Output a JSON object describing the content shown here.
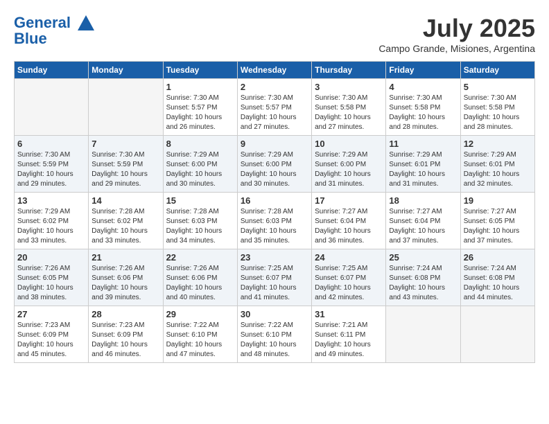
{
  "header": {
    "logo_line1": "General",
    "logo_line2": "Blue",
    "month": "July 2025",
    "location": "Campo Grande, Misiones, Argentina"
  },
  "days_of_week": [
    "Sunday",
    "Monday",
    "Tuesday",
    "Wednesday",
    "Thursday",
    "Friday",
    "Saturday"
  ],
  "weeks": [
    [
      {
        "num": "",
        "info": ""
      },
      {
        "num": "",
        "info": ""
      },
      {
        "num": "1",
        "info": "Sunrise: 7:30 AM\nSunset: 5:57 PM\nDaylight: 10 hours\nand 26 minutes."
      },
      {
        "num": "2",
        "info": "Sunrise: 7:30 AM\nSunset: 5:57 PM\nDaylight: 10 hours\nand 27 minutes."
      },
      {
        "num": "3",
        "info": "Sunrise: 7:30 AM\nSunset: 5:58 PM\nDaylight: 10 hours\nand 27 minutes."
      },
      {
        "num": "4",
        "info": "Sunrise: 7:30 AM\nSunset: 5:58 PM\nDaylight: 10 hours\nand 28 minutes."
      },
      {
        "num": "5",
        "info": "Sunrise: 7:30 AM\nSunset: 5:58 PM\nDaylight: 10 hours\nand 28 minutes."
      }
    ],
    [
      {
        "num": "6",
        "info": "Sunrise: 7:30 AM\nSunset: 5:59 PM\nDaylight: 10 hours\nand 29 minutes."
      },
      {
        "num": "7",
        "info": "Sunrise: 7:30 AM\nSunset: 5:59 PM\nDaylight: 10 hours\nand 29 minutes."
      },
      {
        "num": "8",
        "info": "Sunrise: 7:29 AM\nSunset: 6:00 PM\nDaylight: 10 hours\nand 30 minutes."
      },
      {
        "num": "9",
        "info": "Sunrise: 7:29 AM\nSunset: 6:00 PM\nDaylight: 10 hours\nand 30 minutes."
      },
      {
        "num": "10",
        "info": "Sunrise: 7:29 AM\nSunset: 6:00 PM\nDaylight: 10 hours\nand 31 minutes."
      },
      {
        "num": "11",
        "info": "Sunrise: 7:29 AM\nSunset: 6:01 PM\nDaylight: 10 hours\nand 31 minutes."
      },
      {
        "num": "12",
        "info": "Sunrise: 7:29 AM\nSunset: 6:01 PM\nDaylight: 10 hours\nand 32 minutes."
      }
    ],
    [
      {
        "num": "13",
        "info": "Sunrise: 7:29 AM\nSunset: 6:02 PM\nDaylight: 10 hours\nand 33 minutes."
      },
      {
        "num": "14",
        "info": "Sunrise: 7:28 AM\nSunset: 6:02 PM\nDaylight: 10 hours\nand 33 minutes."
      },
      {
        "num": "15",
        "info": "Sunrise: 7:28 AM\nSunset: 6:03 PM\nDaylight: 10 hours\nand 34 minutes."
      },
      {
        "num": "16",
        "info": "Sunrise: 7:28 AM\nSunset: 6:03 PM\nDaylight: 10 hours\nand 35 minutes."
      },
      {
        "num": "17",
        "info": "Sunrise: 7:27 AM\nSunset: 6:04 PM\nDaylight: 10 hours\nand 36 minutes."
      },
      {
        "num": "18",
        "info": "Sunrise: 7:27 AM\nSunset: 6:04 PM\nDaylight: 10 hours\nand 37 minutes."
      },
      {
        "num": "19",
        "info": "Sunrise: 7:27 AM\nSunset: 6:05 PM\nDaylight: 10 hours\nand 37 minutes."
      }
    ],
    [
      {
        "num": "20",
        "info": "Sunrise: 7:26 AM\nSunset: 6:05 PM\nDaylight: 10 hours\nand 38 minutes."
      },
      {
        "num": "21",
        "info": "Sunrise: 7:26 AM\nSunset: 6:06 PM\nDaylight: 10 hours\nand 39 minutes."
      },
      {
        "num": "22",
        "info": "Sunrise: 7:26 AM\nSunset: 6:06 PM\nDaylight: 10 hours\nand 40 minutes."
      },
      {
        "num": "23",
        "info": "Sunrise: 7:25 AM\nSunset: 6:07 PM\nDaylight: 10 hours\nand 41 minutes."
      },
      {
        "num": "24",
        "info": "Sunrise: 7:25 AM\nSunset: 6:07 PM\nDaylight: 10 hours\nand 42 minutes."
      },
      {
        "num": "25",
        "info": "Sunrise: 7:24 AM\nSunset: 6:08 PM\nDaylight: 10 hours\nand 43 minutes."
      },
      {
        "num": "26",
        "info": "Sunrise: 7:24 AM\nSunset: 6:08 PM\nDaylight: 10 hours\nand 44 minutes."
      }
    ],
    [
      {
        "num": "27",
        "info": "Sunrise: 7:23 AM\nSunset: 6:09 PM\nDaylight: 10 hours\nand 45 minutes."
      },
      {
        "num": "28",
        "info": "Sunrise: 7:23 AM\nSunset: 6:09 PM\nDaylight: 10 hours\nand 46 minutes."
      },
      {
        "num": "29",
        "info": "Sunrise: 7:22 AM\nSunset: 6:10 PM\nDaylight: 10 hours\nand 47 minutes."
      },
      {
        "num": "30",
        "info": "Sunrise: 7:22 AM\nSunset: 6:10 PM\nDaylight: 10 hours\nand 48 minutes."
      },
      {
        "num": "31",
        "info": "Sunrise: 7:21 AM\nSunset: 6:11 PM\nDaylight: 10 hours\nand 49 minutes."
      },
      {
        "num": "",
        "info": ""
      },
      {
        "num": "",
        "info": ""
      }
    ]
  ]
}
